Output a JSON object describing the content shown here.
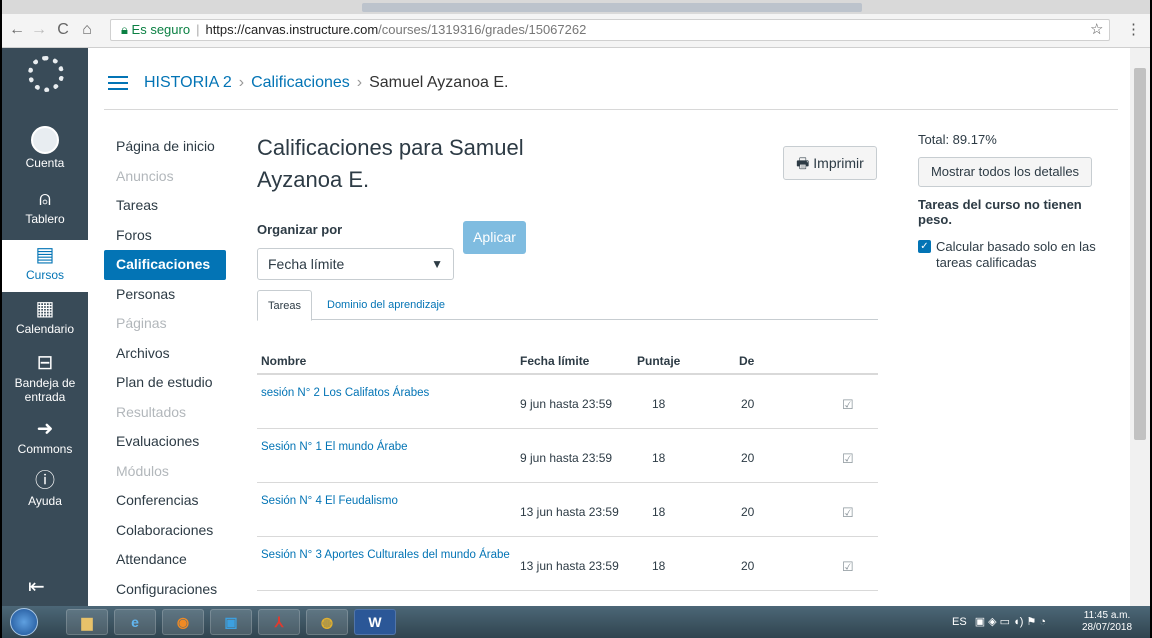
{
  "browser": {
    "secure_label": "Es seguro",
    "url_host": "https://canvas.instructure.com",
    "url_path": "/courses/1319316/grades/15067262"
  },
  "global_nav": {
    "items": [
      {
        "label": "Cuenta"
      },
      {
        "label": "Tablero"
      },
      {
        "label": "Cursos"
      },
      {
        "label": "Calendario"
      },
      {
        "label": "Bandeja de entrada"
      },
      {
        "label": "Commons"
      },
      {
        "label": "Ayuda"
      }
    ]
  },
  "breadcrumb": {
    "course": "HISTORIA 2",
    "section": "Calificaciones",
    "student": "Samuel Ayzanoa E."
  },
  "course_nav": {
    "items": [
      {
        "label": "Página de inicio"
      },
      {
        "label": "Anuncios"
      },
      {
        "label": "Tareas"
      },
      {
        "label": "Foros"
      },
      {
        "label": "Calificaciones"
      },
      {
        "label": "Personas"
      },
      {
        "label": "Páginas"
      },
      {
        "label": "Archivos"
      },
      {
        "label": "Plan de estudio"
      },
      {
        "label": "Resultados"
      },
      {
        "label": "Evaluaciones"
      },
      {
        "label": "Módulos"
      },
      {
        "label": "Conferencias"
      },
      {
        "label": "Colaboraciones"
      },
      {
        "label": "Attendance"
      },
      {
        "label": "Configuraciones"
      }
    ]
  },
  "main": {
    "title": "Calificaciones para Samuel Ayzanoa E.",
    "print_label": "Imprimir",
    "sort_label": "Organizar por",
    "sort_value": "Fecha límite",
    "apply_label": "Aplicar",
    "tabs": [
      "Tareas",
      "Dominio del aprendizaje"
    ],
    "columns": {
      "name": "Nombre",
      "due": "Fecha límite",
      "score": "Puntaje",
      "out_of": "De"
    },
    "rows": [
      {
        "name": "sesión N° 2 Los Califatos Árabes",
        "due": "9 jun hasta 23:59",
        "score": "18",
        "out_of": "20"
      },
      {
        "name": "Sesión N° 1 El mundo Árabe",
        "due": "9 jun hasta 23:59",
        "score": "18",
        "out_of": "20"
      },
      {
        "name": "Sesión N° 4 El Feudalismo",
        "due": "13 jun hasta 23:59",
        "score": "18",
        "out_of": "20"
      },
      {
        "name": "Sesión N° 3 Aportes Culturales del mundo Árabe",
        "due": "13 jun hasta 23:59",
        "score": "18",
        "out_of": "20"
      }
    ]
  },
  "sidebar": {
    "total": "Total: 89.17%",
    "details_label": "Mostrar todos los detalles",
    "weight_note": "Tareas del curso no tienen peso.",
    "calc_label": "Calcular basado solo en las tareas calificadas"
  },
  "taskbar": {
    "lang": "ES",
    "time": "11:45 a.m.",
    "date": "28/07/2018"
  },
  "colors": {
    "accent": "#0374b5",
    "nav_bg": "#394b58",
    "apply": "#7fbce0"
  }
}
